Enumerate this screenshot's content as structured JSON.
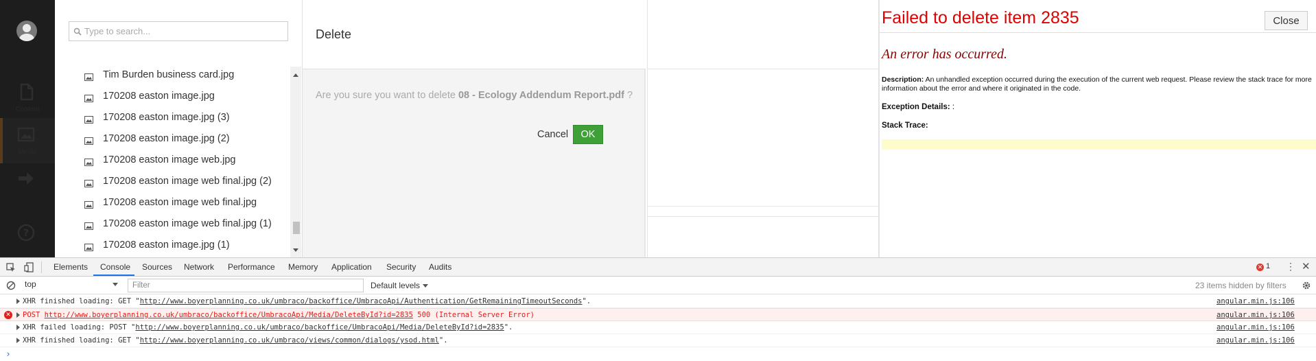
{
  "nav": {
    "items": [
      {
        "label": "Content",
        "icon": "document-icon"
      },
      {
        "label": "Media",
        "icon": "image-icon"
      },
      {
        "label": "Forms",
        "icon": "arrow-right-icon"
      },
      {
        "label": "Help",
        "icon": "question-icon"
      }
    ]
  },
  "search": {
    "placeholder": "Type to search..."
  },
  "tree": {
    "items": [
      "Tim Burden business card.jpg",
      "170208 easton image.jpg",
      "170208 easton image.jpg (3)",
      "170208 easton image.jpg (2)",
      "170208 easton image web.jpg",
      "170208 easton image web final.jpg (2)",
      "170208 easton image web final.jpg",
      "170208 easton image web final.jpg (1)",
      "170208 easton image.jpg (1)"
    ]
  },
  "dialog": {
    "title": "Delete",
    "message_prefix": "Are you sure you want to delete ",
    "item_name": "08 - Ecology Addendum Report.pdf",
    "message_suffix": " ?",
    "cancel_label": "Cancel",
    "ok_label": "OK"
  },
  "error": {
    "title": "Failed to delete item 2835",
    "close_label": "Close",
    "heading": "An error has occurred.",
    "description_label": "Description:",
    "description_text": " An unhandled exception occurred during the execution of the current web request. Please review the stack trace for more information about the error and where it originated in the code.",
    "exception_label": "Exception Details:",
    "exception_text": " :",
    "stack_label": "Stack Trace:"
  },
  "devtools": {
    "tabs": [
      "Elements",
      "Console",
      "Sources",
      "Network",
      "Performance",
      "Memory",
      "Application",
      "Security",
      "Audits"
    ],
    "active_tab": "Console",
    "error_count": "1",
    "context": "top",
    "filter_placeholder": "Filter",
    "levels": "Default levels",
    "hidden_text": "23 items hidden by filters",
    "logs": [
      {
        "prefix": "XHR finished loading: GET \"",
        "url": "http://www.boyerplanning.co.uk/umbraco/backoffice/UmbracoApi/Authentication/GetRemainingTimeoutSeconds",
        "suffix": "\".",
        "source": "angular.min.js:106",
        "type": "info"
      },
      {
        "prefix": "POST ",
        "url": "http://www.boyerplanning.co.uk/umbraco/backoffice/UmbracoApi/Media/DeleteById?id=2835",
        "suffix": " 500 (Internal Server Error)",
        "source": "angular.min.js:106",
        "type": "error"
      },
      {
        "prefix": "XHR failed loading: POST \"",
        "url": "http://www.boyerplanning.co.uk/umbraco/backoffice/UmbracoApi/Media/DeleteById?id=2835",
        "suffix": "\".",
        "source": "angular.min.js:106",
        "type": "info"
      },
      {
        "prefix": "XHR finished loading: GET \"",
        "url": "http://www.boyerplanning.co.uk/umbraco/views/common/dialogs/ysod.html",
        "suffix": "\".",
        "source": "angular.min.js:106",
        "type": "info"
      }
    ],
    "prompt": "›"
  }
}
